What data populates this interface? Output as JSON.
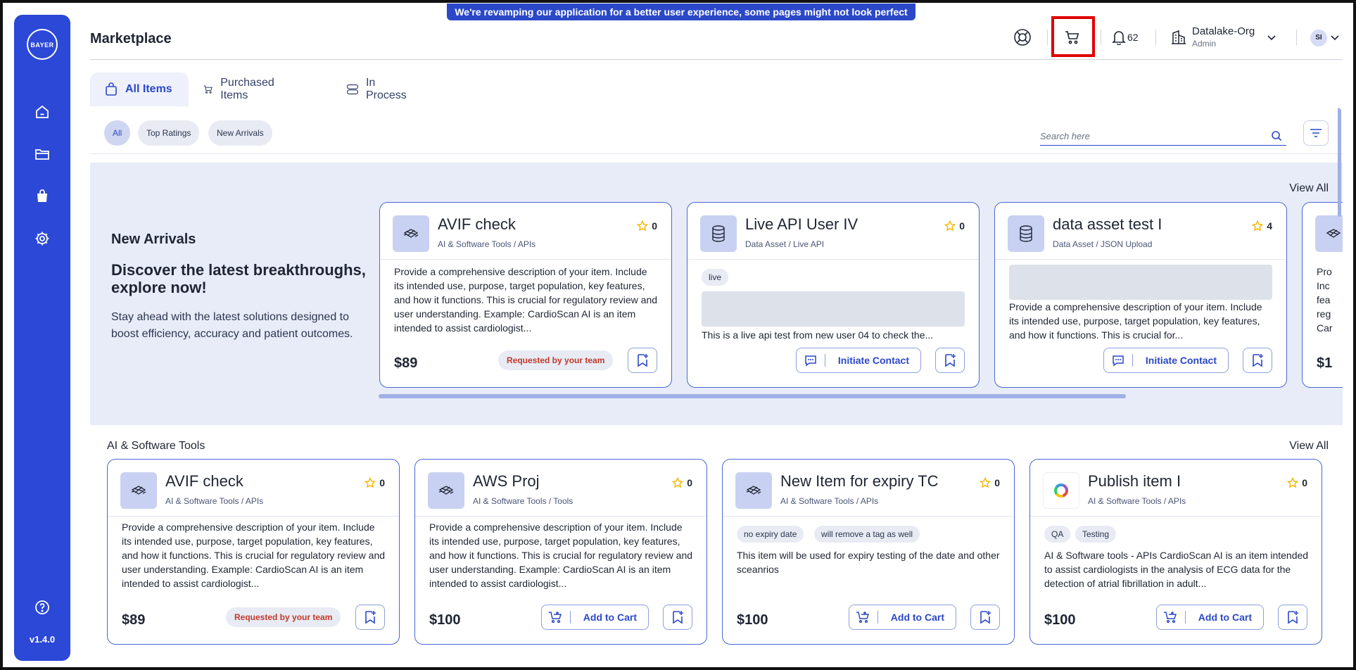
{
  "banner": "We're revamping our application for a better user experience, some pages might not look perfect yet!",
  "sidebar": {
    "logo_h": "BAYER",
    "logo_v": "BAYER",
    "version": "v1.4.0"
  },
  "header": {
    "title": "Marketplace",
    "notif_count": "62",
    "org_name": "Datalake-Org",
    "org_role": "Admin",
    "avatar": "SI"
  },
  "tabs": [
    "All Items",
    "Purchased Items",
    "In Process"
  ],
  "filters": {
    "chips": [
      "All",
      "Top Ratings",
      "New Arrivals"
    ],
    "search_placeholder": "Search here"
  },
  "new_arrivals": {
    "title": "New Arrivals",
    "headline": "Discover the latest breakthroughs, explore now!",
    "desc": "Stay ahead with the latest solutions designed to boost efficiency, accuracy and patient outcomes.",
    "view_all": "View All",
    "cards": [
      {
        "title": "AVIF check",
        "category": "AI & Software Tools / APIs",
        "rating": "0",
        "desc": "Provide a comprehensive description of your item. Include its intended use, purpose, target population, key features, and how it functions. This is crucial for regulatory review and user understanding. Example: CardioScan AI is an item intended to assist cardiologist...",
        "price": "$89",
        "requested": "Requested by your team"
      },
      {
        "title": "Live API User IV",
        "category": "Data Asset / Live API",
        "rating": "0",
        "tag": "live",
        "desc": "This is a live api test from new user 04 to check the...",
        "action": "Initiate Contact"
      },
      {
        "title": "data asset test I",
        "category": "Data Asset / JSON Upload",
        "rating": "4",
        "desc": "Provide a comprehensive description of your item. Include its intended use, purpose, target population, key features, and how it functions. This is crucial for...",
        "action": "Initiate Contact"
      },
      {
        "desc": "Pro Inc fea reg Car",
        "price": "$1"
      }
    ]
  },
  "ai_tools": {
    "title": "AI & Software Tools",
    "view_all": "View All",
    "cards": [
      {
        "title": "AVIF check",
        "category": "AI & Software Tools / APIs",
        "rating": "0",
        "desc": "Provide a comprehensive description of your item. Include its intended use, purpose, target population, key features, and how it functions. This is crucial for regulatory review and user understanding. Example: CardioScan AI is an item intended to assist cardiologist...",
        "price": "$89",
        "requested": "Requested by your team"
      },
      {
        "title": "AWS Proj",
        "category": "AI & Software Tools / Tools",
        "rating": "0",
        "desc": "Provide a comprehensive description of your item. Include its intended use, purpose, target population, key features, and how it functions. This is crucial for regulatory review and user understanding. Example: CardioScan AI is an item intended to assist cardiologist...",
        "price": "$100",
        "action": "Add to Cart"
      },
      {
        "title": "New Item for expiry TC",
        "category": "AI & Software Tools / APIs",
        "rating": "0",
        "tags": [
          "no expiry date",
          "will remove a tag as well"
        ],
        "desc": "This item will be used for expiry testing of the date and other sceanrios",
        "price": "$100",
        "action": "Add to Cart"
      },
      {
        "title": "Publish item I",
        "category": "AI & Software Tools / APIs",
        "rating": "0",
        "tags": [
          "QA",
          "Testing"
        ],
        "desc": "AI & Software tools - APIs CardioScan AI is an item intended to assist cardiologists in the analysis of ECG data for the detection of atrial fibrillation in adult...",
        "price": "$100",
        "action": "Add to Cart"
      }
    ]
  },
  "colors": {
    "primary": "#2b48d6",
    "accent_text": "#2b48c8",
    "requested_text": "#c0392b",
    "star": "#f2b600",
    "highlight": "#e00000"
  }
}
